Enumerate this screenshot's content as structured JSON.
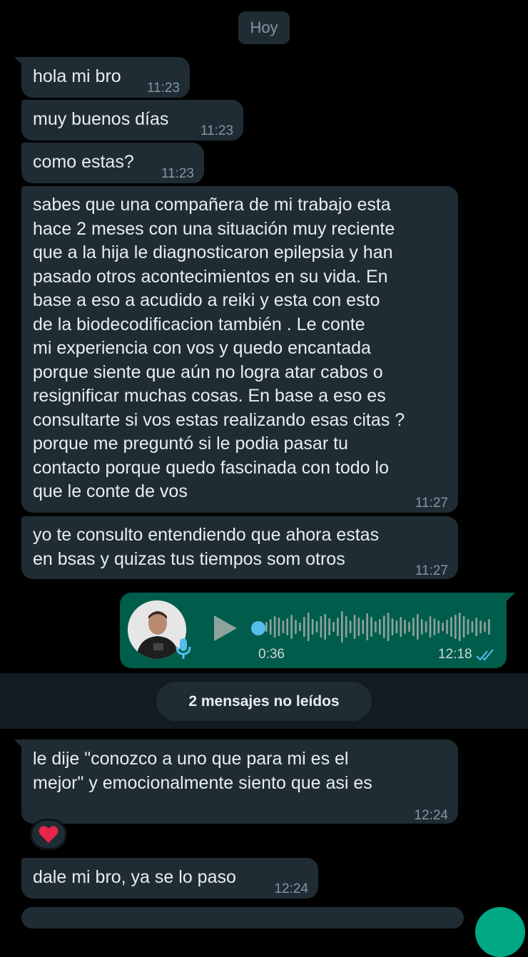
{
  "date_chip": "Hoy",
  "messages_before": [
    {
      "text": "hola mi bro",
      "time": "11:23"
    },
    {
      "text": "muy buenos días",
      "time": "11:23"
    },
    {
      "text": "como estas?",
      "time": "11:23"
    },
    {
      "text": "sabes que una compañera de mi trabajo esta\nhace 2 meses con una situación muy reciente\nque a la hija le diagnosticaron epilepsia y han\npasado otros acontecimientos en su vida. En\nbase a eso a acudido a reiki y esta con esto\nde la biodecodificacion también . Le conte\nmi experiencia con vos y quedo encantada\nporque siente que aún no logra atar cabos o\nresignificar muchas cosas. En base a eso es\nconsultarte si vos estas realizando esas citas ?\nporque me preguntó si le podia pasar tu\ncontacto porque quedo fascinada con todo lo\nque le conte de vos",
      "time": "11:27"
    },
    {
      "text": "yo te consulto entendiendo que ahora estas\nen bsas y quizas tus tiempos som otros",
      "time": "11:27"
    }
  ],
  "voice_note": {
    "duration": "0:36",
    "time": "12:18",
    "progress": 0,
    "status_icon": "double-check-read-icon"
  },
  "unread_label": "2 mensajes no leídos",
  "messages_after": [
    {
      "text": "le dije \"conozco a uno que para mi es el\nmejor\" y emocionalmente siento que asi es",
      "time": "12:24",
      "reaction": "❤️"
    },
    {
      "text": "dale mi bro, ya se lo paso",
      "time": "12:24"
    }
  ],
  "colors": {
    "incoming_bubble": "#1f2c34",
    "outgoing_bubble": "#005c4b",
    "read_ticks": "#53bdeb",
    "meta_text": "#8696a0"
  }
}
